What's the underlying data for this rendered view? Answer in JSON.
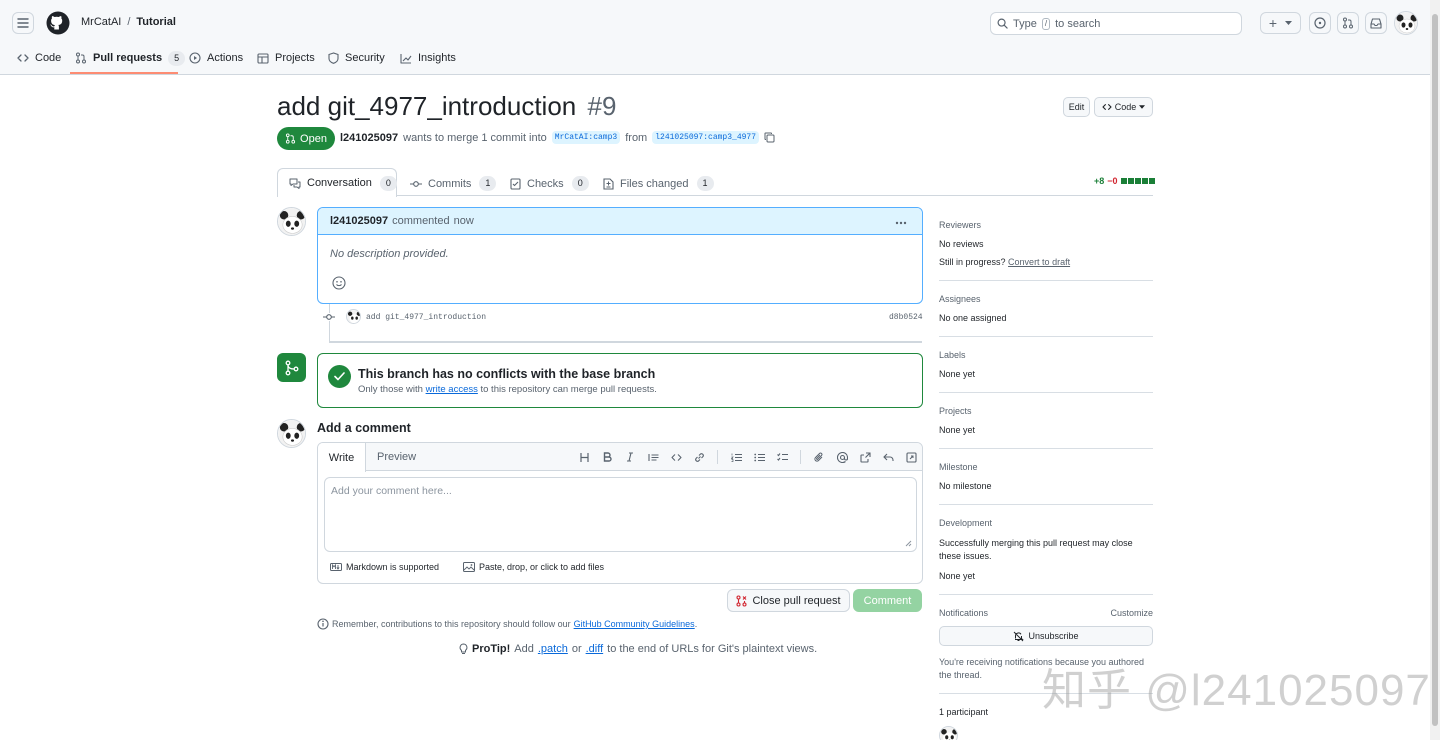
{
  "header": {
    "owner": "MrCatAI",
    "separator": "/",
    "repo": "Tutorial",
    "search_type": "Type",
    "search_key": "/",
    "search_rest": "to search",
    "plus": "+"
  },
  "repo_nav": {
    "code": "Code",
    "pulls": "Pull requests",
    "pulls_count": "5",
    "actions": "Actions",
    "projects": "Projects",
    "security": "Security",
    "insights": "Insights"
  },
  "pr": {
    "title": "add git_4977_introduction",
    "number": "#9",
    "state": "Open",
    "author": "l241025097",
    "wants_to_merge": "wants to merge 1 commit into",
    "base_branch": "MrCatAI:camp3",
    "from": "from",
    "head_branch": "l241025097:camp3_4977",
    "edit": "Edit",
    "code_btn": "Code"
  },
  "tabs": [
    {
      "label": "Conversation",
      "count": "0"
    },
    {
      "label": "Commits",
      "count": "1"
    },
    {
      "label": "Checks",
      "count": "0"
    },
    {
      "label": "Files changed",
      "count": "1"
    }
  ],
  "diffstat": {
    "add": "+8",
    "del": "−0"
  },
  "comment": {
    "author": "l241025097",
    "action": "commented",
    "time": "now",
    "body": "No description provided."
  },
  "commit": {
    "message": "add git_4977_introduction",
    "sha": "d8b0524"
  },
  "merge": {
    "title": "This branch has no conflicts with the base branch",
    "sub_pre": "Only those with",
    "sub_link": "write access",
    "sub_post": "to this repository can merge pull requests."
  },
  "composer": {
    "heading": "Add a comment",
    "tab_write": "Write",
    "tab_preview": "Preview",
    "placeholder": "Add your comment here...",
    "markdown": "Markdown is supported",
    "attach": "Paste, drop, or click to add files",
    "close_btn": "Close pull request",
    "comment_btn": "Comment"
  },
  "footer": {
    "remember_pre": "Remember, contributions to this repository should follow our",
    "guidelines": "GitHub Community Guidelines",
    "remember_post": ".",
    "protip_label": "ProTip!",
    "protip_add": "Add",
    "patch": ".patch",
    "or": "or",
    "diff": ".diff",
    "protip_rest": "to the end of URLs for Git's plaintext views."
  },
  "sidebar": {
    "reviewers_h": "Reviewers",
    "reviewers_v": "No reviews",
    "still_progress": "Still in progress?",
    "convert_draft": "Convert to draft",
    "assignees_h": "Assignees",
    "assignees_v": "No one assigned",
    "labels_h": "Labels",
    "labels_v": "None yet",
    "projects_h": "Projects",
    "projects_v": "None yet",
    "milestone_h": "Milestone",
    "milestone_v": "No milestone",
    "development_h": "Development",
    "development_desc": "Successfully merging this pull request may close these issues.",
    "development_v": "None yet",
    "notifications_h": "Notifications",
    "customize": "Customize",
    "unsubscribe": "Unsubscribe",
    "notif_desc": "You're receiving notifications because you authored the thread.",
    "participants": "1 participant"
  },
  "watermark": "知乎 @l241025097",
  "colors": {
    "accent": "#0969da",
    "open": "#1f883d",
    "muted": "#59636e",
    "border": "#d0d7de"
  }
}
